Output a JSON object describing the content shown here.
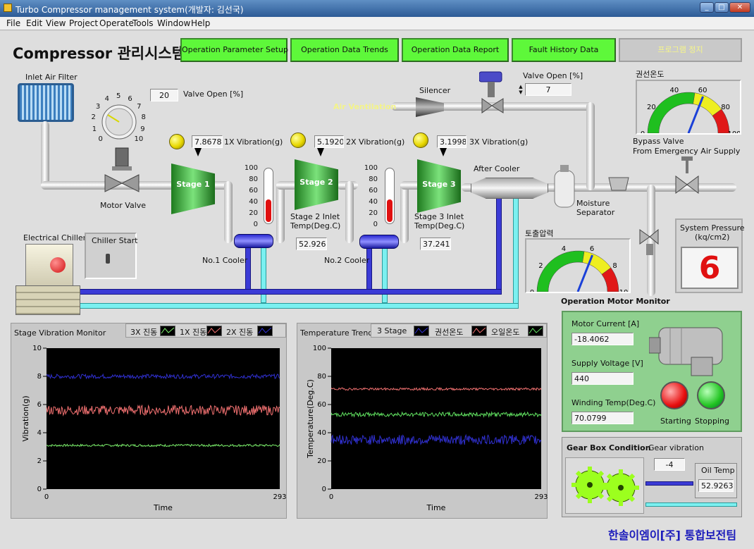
{
  "window": {
    "title": "Turbo Compressor management system(개발자: 김선국)"
  },
  "menu": [
    "File",
    "Edit",
    "View",
    "Project",
    "Operate",
    "Tools",
    "Window",
    "Help"
  ],
  "header": {
    "title": "Compressor 관리시스템"
  },
  "nav": [
    "Operation Parameter Setup",
    "Operation Data Trends",
    "Operation Data Report",
    "Fault  History Data",
    "프로그램 정지"
  ],
  "process": {
    "inlet_filter": "Inlet Air Filter",
    "valve_open_value": "20",
    "valve_open_label": "Valve Open [%]",
    "motor_valve": "Motor Valve",
    "knob_ticks": [
      "0",
      "1",
      "2",
      "3",
      "4",
      "5",
      "6",
      "7",
      "8",
      "9",
      "10"
    ],
    "stage1": "Stage 1",
    "stage2": "Stage 2",
    "stage3": "Stage 3",
    "vib1_value": "7.8678",
    "vib1_label": "1X Vibration(g)",
    "vib2_value": "5.19203",
    "vib2_label": "2X Vibration(g)",
    "vib3_value": "3.19986",
    "vib3_label": "3X Vibration(g)",
    "thermo_ticks": [
      "100",
      "80",
      "60",
      "40",
      "20",
      "0"
    ],
    "thermo1_level": 0.42,
    "thermo2_level": 0.42,
    "stage2_inlet_label": "Stage 2 Inlet\nTemp(Deg.C)",
    "stage2_inlet_value": "52.9263",
    "stage3_inlet_label": "Stage 3 Inlet\nTemp(Deg.C)",
    "stage3_inlet_value": "37.2418",
    "cooler1": "No.1 Cooler",
    "cooler2": "No.2 Cooler",
    "after_cooler": "After Cooler",
    "silencer": "Silencer",
    "air_ventilation": "Air Ventilation",
    "valve2_label": "Valve Open [%]",
    "valve2_value": "7",
    "moisture_sep": "Moisture\nSeparator",
    "bypass_valve": "Bypass Valve\nFrom Emergency Air Supply",
    "chiller": "Electrical Chiller",
    "chiller_start": "Chiller Start",
    "winding_gauge_title": "권선온도",
    "winding_gauge_ticks": [
      "0",
      "20",
      "40",
      "60",
      "80",
      "100"
    ],
    "winding_gauge_value": 62,
    "discharge_gauge_title": "토출압력",
    "discharge_gauge_ticks": [
      "0",
      "2",
      "4",
      "6",
      "8",
      "10"
    ],
    "discharge_gauge_value": 6.2,
    "system_pressure_label": "System Pressure\n(kq/cm2)",
    "system_pressure_value": "6"
  },
  "motor": {
    "title": "Operation Motor Monitor",
    "current_label": "Motor Current [A]",
    "current_value": "-18.4062",
    "voltage_label": "Supply Voltage [V]",
    "voltage_value": "440",
    "winding_label": "Winding Temp(Deg.C)",
    "winding_value": "70.0799",
    "starting": "Starting",
    "stopping": "Stopping",
    "colors": {
      "starting": "#e81010",
      "stopping": "#22c422"
    }
  },
  "gearbox": {
    "title": "Gear Box Condition",
    "vib_label": "Gear vibration",
    "vib_value": "-4",
    "oil_label": "Oil Temp",
    "oil_value": "52.9263"
  },
  "chart_data": [
    {
      "type": "line",
      "title": "Stage Vibration Monitor",
      "xlabel": "Time",
      "ylabel": "Vibration(g)",
      "xlim": [
        0,
        293
      ],
      "ylim": [
        0,
        10
      ],
      "xticks": [
        "0",
        "293"
      ],
      "yticks": [
        "0",
        "2",
        "4",
        "6",
        "8",
        "10"
      ],
      "legend": [
        "3X 진동",
        "1X 진동",
        "2X 진동"
      ],
      "series": [
        {
          "name": "3X 진동",
          "color": "#7cf06c",
          "mean": 3.1,
          "noise": 0.08
        },
        {
          "name": "2X 진동",
          "color": "#3030d0",
          "mean": 8.0,
          "noise": 0.15
        },
        {
          "name": "1X 진동",
          "color": "#f07070",
          "mean": 5.6,
          "noise": 0.35
        }
      ]
    },
    {
      "type": "line",
      "title": "Temperature Trend",
      "xlabel": "Time",
      "ylabel": "Temperature(Deg.C)",
      "xlim": [
        0,
        293
      ],
      "ylim": [
        0,
        100
      ],
      "xticks": [
        "0",
        "293"
      ],
      "yticks": [
        "0",
        "20",
        "40",
        "60",
        "80",
        "100"
      ],
      "legend": [
        "3 Stage",
        "권선온도",
        "오일온도"
      ],
      "series": [
        {
          "name": "권선온도",
          "color": "#f07070",
          "mean": 71,
          "noise": 0.8
        },
        {
          "name": "오일온도",
          "color": "#60e060",
          "mean": 53,
          "noise": 1.5
        },
        {
          "name": "3 Stage",
          "color": "#3030d0",
          "mean": 35,
          "noise": 3.5
        }
      ]
    }
  ],
  "footer": "한솔이엠이[주] 통합보전팀"
}
